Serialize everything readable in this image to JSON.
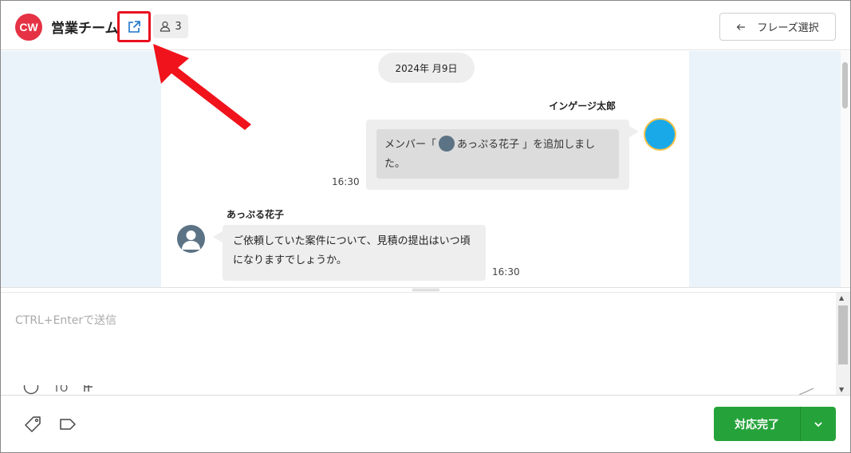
{
  "header": {
    "logo_text": "CW",
    "room_title": "営業チーム",
    "member_count": "3",
    "phrase_button_label": "フレーズ選択",
    "icons": [
      "external-link-icon",
      "person-icon",
      "arrow-left-icon"
    ]
  },
  "chat": {
    "date_label": "2024年  月9日",
    "messages": [
      {
        "sender": "インゲージ太郎",
        "text_before": "メンバー「",
        "text_after": "あっぷる花子 」を追加しました。",
        "time": "16:30"
      },
      {
        "sender": "あっぷる花子",
        "text": "ご依頼していた案件について、見積の提出はいつ頃になりますでしょうか。",
        "time": "16:30"
      }
    ]
  },
  "input": {
    "placeholder": "CTRL+Enterで送信",
    "tool_to_label": "TO"
  },
  "footer": {
    "done_label": "対応完了"
  },
  "colors": {
    "accent_green": "#25a33a",
    "logo_red": "#e53244",
    "highlight_red": "#e8101e",
    "chat_bg": "#eaf3fa"
  }
}
